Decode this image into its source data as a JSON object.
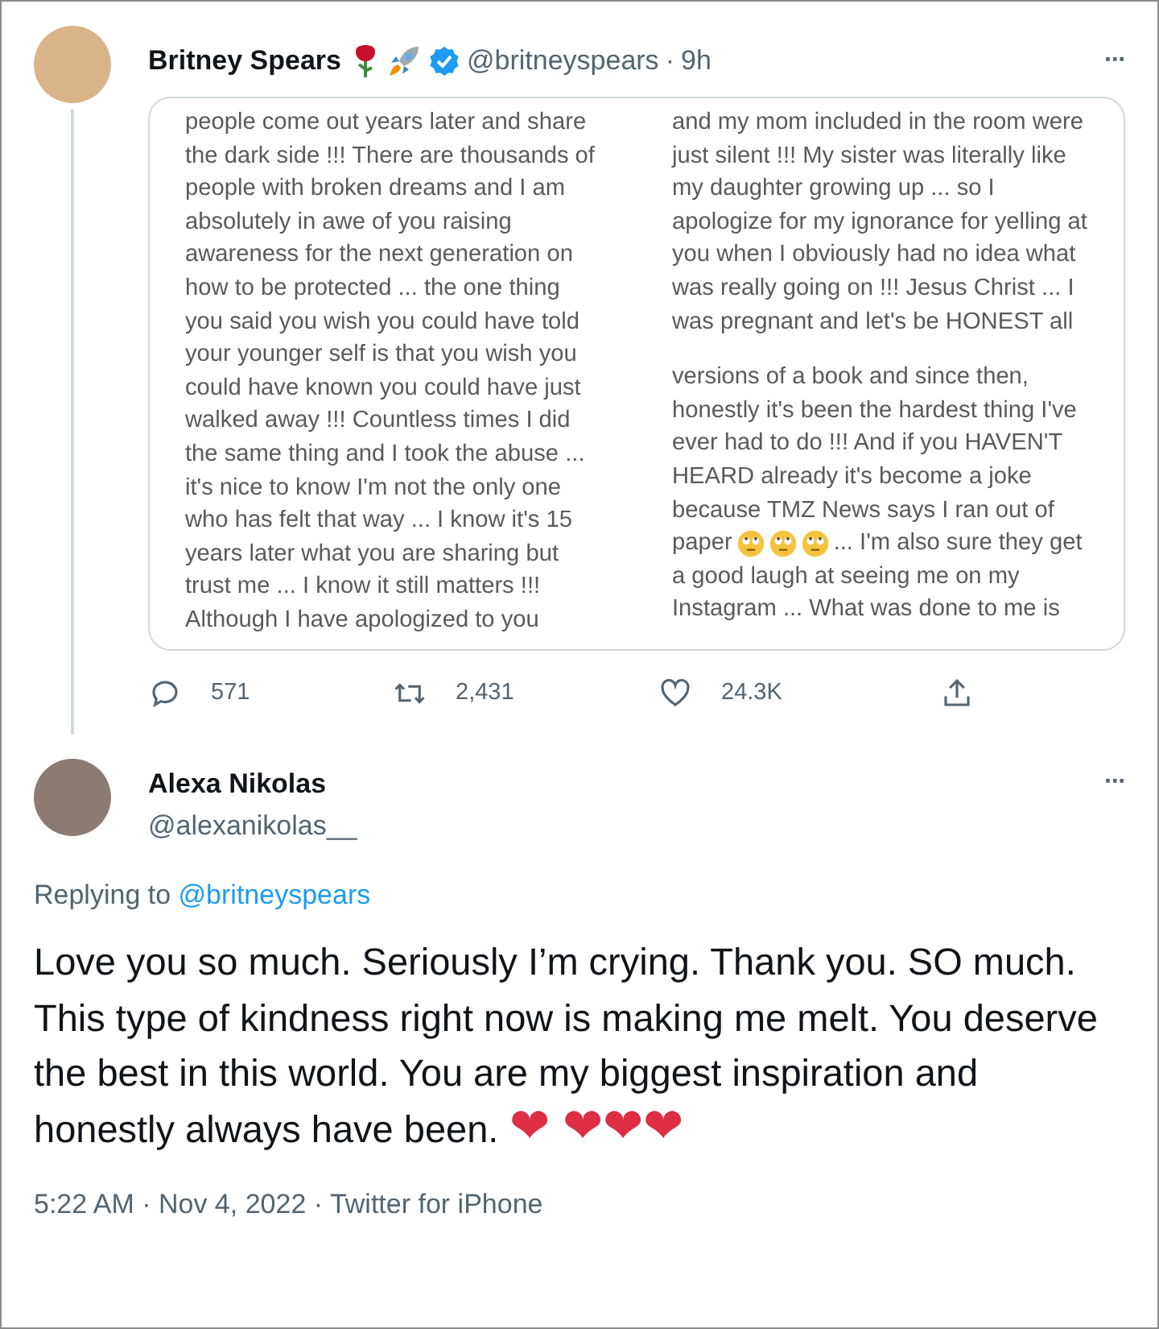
{
  "tweet": {
    "author": "Britney Spears",
    "verified": true,
    "handle": "@britneyspears",
    "separator": "·",
    "time": "9h",
    "more": "···",
    "media": {
      "left": [
        "people come out years later and share",
        "the dark side !!! There are thousands of",
        "people with broken dreams and I am",
        "absolutely in awe of you raising",
        "awareness for the next generation on",
        "how to be protected ... the one thing",
        "you said you wish you could have told",
        "your younger self is that you wish you",
        "could have known you could have just",
        "walked away !!! Countless times I did",
        "the same thing and I took the abuse ...",
        "it's nice to know I'm not the only one",
        "who has felt that way ... I know it's 15",
        "years later what you are sharing but",
        "trust me ... I know it still matters !!!",
        "Although I have apologized to you"
      ],
      "right_top": [
        "and my mom included in the room were",
        "just silent !!! My sister was literally like",
        "my daughter growing up ... so I",
        "apologize for my ignorance for yelling at",
        "you when I obviously had no idea what",
        "was really going on !!! Jesus Christ ... I",
        "was pregnant and let's be HONEST all"
      ],
      "right_bottom": [
        {
          "kind": "text",
          "text": "versions of a book and since then,"
        },
        {
          "kind": "text",
          "text": "honestly it's been the hardest thing I've"
        },
        {
          "kind": "text",
          "text": "ever had to do !!! And if you HAVEN'T"
        },
        {
          "kind": "text",
          "text": "HEARD already it's become a joke"
        },
        {
          "kind": "text",
          "text": "because TMZ News says I ran out of"
        },
        {
          "kind": "emoji",
          "before": "paper",
          "after": "... I'm also sure they get"
        },
        {
          "kind": "text",
          "text": "a good laugh at seeing me on my"
        },
        {
          "kind": "text",
          "text": "Instagram ... What was done to me is"
        }
      ]
    },
    "actions": [
      {
        "kind": "reply",
        "count": "571"
      },
      {
        "kind": "retweet",
        "count": "2,431"
      },
      {
        "kind": "like",
        "count": "24.3K"
      },
      {
        "kind": "share"
      }
    ]
  },
  "reply": {
    "author": "Alexa Nikolas",
    "handle": "@alexanikolas__",
    "more": "···",
    "replying_prefix": "Replying to",
    "replying_handle": "@britneyspears",
    "text": "Love you so much. Seriously I’m crying. Thank you. SO much. This type of kindness right now is making me melt. You deserve the best in this world. You are my biggest inspiration and honestly always have been.",
    "hearts": "❤ ❤❤❤",
    "meta": "5:22 AM · Nov 4, 2022 · Twitter for iPhone"
  }
}
